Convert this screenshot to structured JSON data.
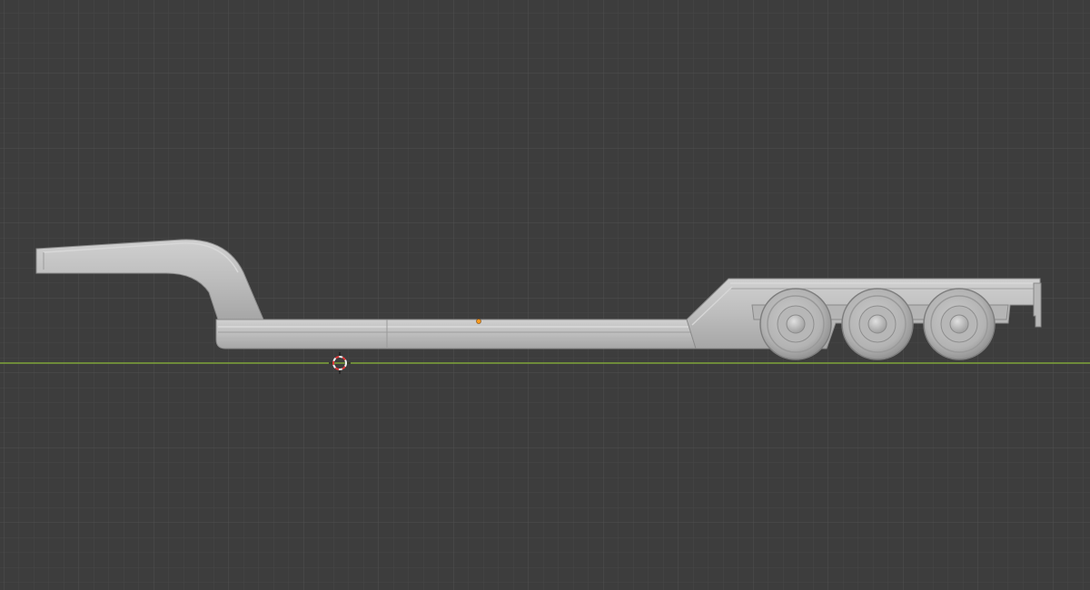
{
  "viewport": {
    "view": "side-orthographic",
    "background_color": "#3d3d3d",
    "grid_minor_color": "#464646",
    "grid_major_color": "#4f4f4f",
    "x_axis_color": "#7fa33a",
    "grid_visible": true
  },
  "model": {
    "object": "lowboy-trailer",
    "material_color": "#bdbdbd",
    "highlight_color": "#d2d2d2",
    "shadow_color": "#8a8a8a",
    "axles": 3
  },
  "origin_point_color": "#ff9a1f",
  "cursor": {
    "icon": "3d-cursor-icon",
    "ring_color_a": "#e23a3a",
    "ring_color_b": "#f0f0f0"
  }
}
